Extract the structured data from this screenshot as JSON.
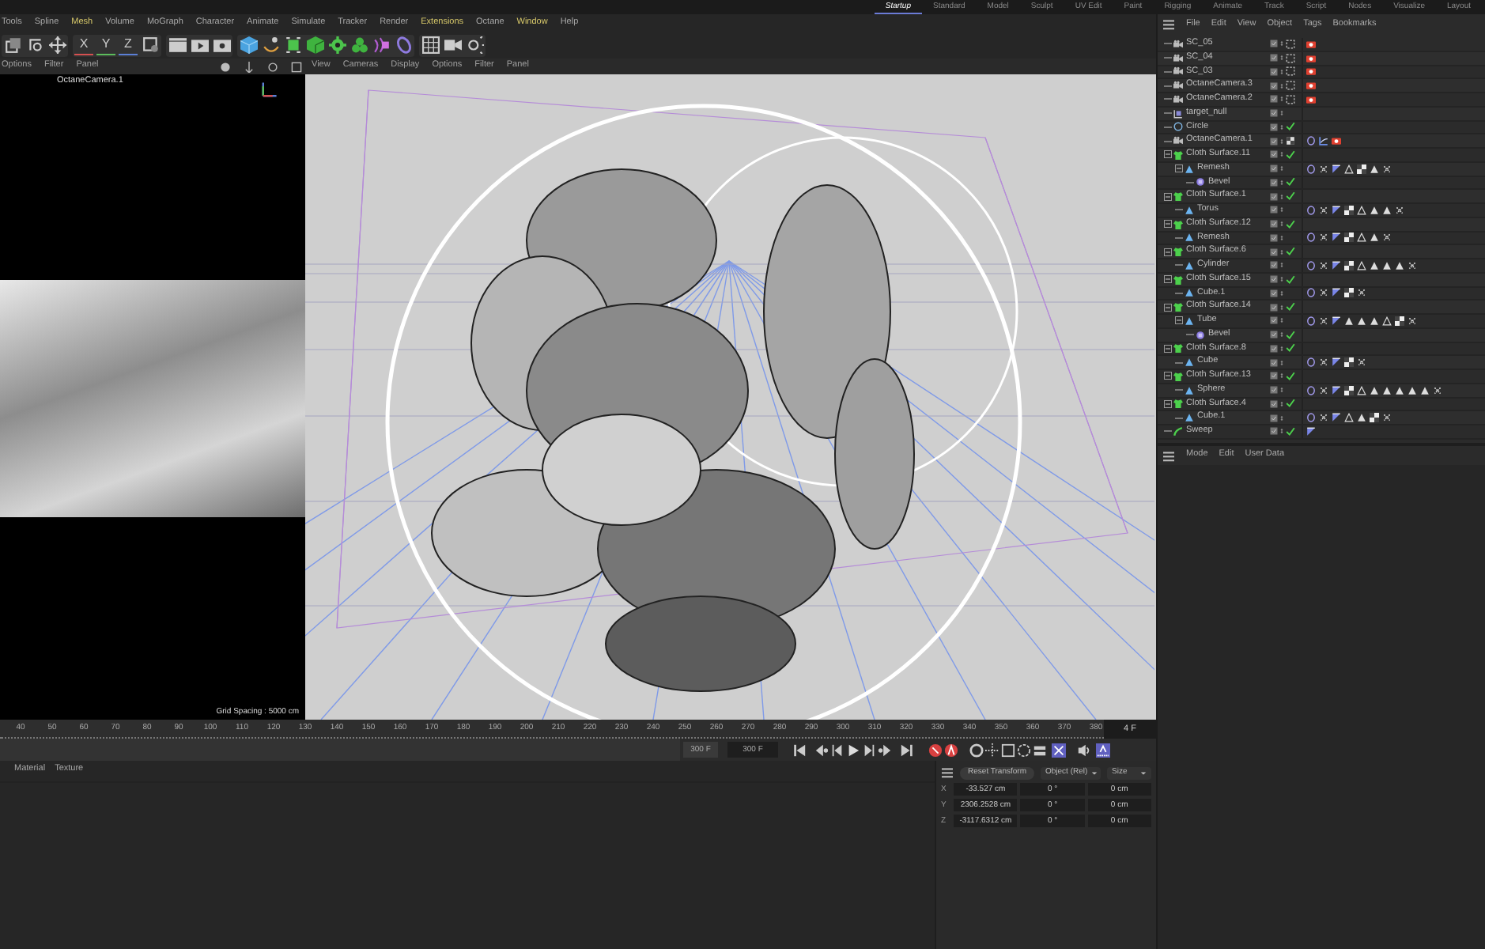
{
  "layouts": [
    {
      "label": "Startup",
      "selected": true
    },
    {
      "label": "Standard",
      "selected": false
    },
    {
      "label": "Model",
      "selected": false
    },
    {
      "label": "Sculpt",
      "selected": false
    },
    {
      "label": "UV Edit",
      "selected": false
    },
    {
      "label": "Paint",
      "selected": false
    },
    {
      "label": "Rigging",
      "selected": false
    },
    {
      "label": "Animate",
      "selected": false
    },
    {
      "label": "Track",
      "selected": false
    },
    {
      "label": "Script",
      "selected": false
    },
    {
      "label": "Nodes",
      "selected": false
    },
    {
      "label": "Visualize",
      "selected": false
    },
    {
      "label": "Layout",
      "selected": false
    }
  ],
  "menu": [
    {
      "label": "Tools",
      "highlight": false
    },
    {
      "label": "Spline",
      "highlight": false
    },
    {
      "label": "Mesh",
      "highlight": true
    },
    {
      "label": "Volume",
      "highlight": false
    },
    {
      "label": "MoGraph",
      "highlight": false
    },
    {
      "label": "Character",
      "highlight": false
    },
    {
      "label": "Animate",
      "highlight": false
    },
    {
      "label": "Simulate",
      "highlight": false
    },
    {
      "label": "Tracker",
      "highlight": false
    },
    {
      "label": "Render",
      "highlight": false
    },
    {
      "label": "Extensions",
      "highlight": true
    },
    {
      "label": "Octane",
      "highlight": false
    },
    {
      "label": "Window",
      "highlight": true
    },
    {
      "label": "Help",
      "highlight": false
    }
  ],
  "axis_buttons": [
    "X",
    "Y",
    "Z"
  ],
  "left_viewport": {
    "menu": [
      "Options",
      "Filter",
      "Panel"
    ],
    "camera": "OctaneCamera.1",
    "grid_spacing": "Grid Spacing : 5000 cm"
  },
  "viewport": {
    "menu": [
      "View",
      "Cameras",
      "Display",
      "Options",
      "Filter",
      "Panel"
    ]
  },
  "object_manager": {
    "menu": [
      "File",
      "Edit",
      "View",
      "Object",
      "Tags",
      "Bookmarks"
    ],
    "objects": [
      {
        "name": "SC_05",
        "kind": "camera",
        "check": false,
        "badge": {
          "kind": "dotted"
        },
        "tags": [
          {
            "kind": "red"
          }
        ]
      },
      {
        "name": "SC_04",
        "kind": "camera",
        "check": false,
        "badge": {
          "kind": "dotted"
        },
        "tags": [
          {
            "kind": "red"
          }
        ]
      },
      {
        "name": "SC_03",
        "kind": "camera",
        "check": false,
        "badge": {
          "kind": "dotted"
        },
        "tags": [
          {
            "kind": "red"
          }
        ]
      },
      {
        "name": "OctaneCamera.3",
        "kind": "camera",
        "check": false,
        "badge": {
          "kind": "dotted"
        },
        "tags": [
          {
            "kind": "red"
          }
        ]
      },
      {
        "name": "OctaneCamera.2",
        "kind": "camera",
        "check": false,
        "badge": {
          "kind": "dotted"
        },
        "tags": [
          {
            "kind": "red"
          }
        ]
      },
      {
        "name": "target_null",
        "kind": "null",
        "check": false
      },
      {
        "name": "Circle",
        "kind": "circle",
        "check": true
      },
      {
        "name": "OctaneCamera.1",
        "kind": "camera",
        "check": false,
        "badge": {
          "kind": "checker"
        },
        "tags": [
          {
            "kind": "octane"
          },
          {
            "kind": "curve"
          },
          {
            "kind": "red"
          }
        ]
      },
      {
        "name": "Cloth Surface.11",
        "kind": "cloth",
        "check": true,
        "expanded": true,
        "children": [
          {
            "name": "Remesh",
            "kind": "generator",
            "check": false,
            "expanded": true,
            "tags": [
              {
                "kind": "octane"
              },
              {
                "kind": "cross"
              },
              {
                "kind": "flag"
              },
              {
                "kind": "tri-outline"
              },
              {
                "kind": "checker"
              },
              {
                "kind": "tri"
              },
              {
                "kind": "cross"
              }
            ],
            "children": [
              {
                "name": "Bevel",
                "kind": "deformer",
                "check": true
              }
            ]
          }
        ]
      },
      {
        "name": "Cloth Surface.1",
        "kind": "cloth",
        "check": true,
        "expanded": true,
        "children": [
          {
            "name": "Torus",
            "kind": "generator",
            "check": false,
            "tags": [
              {
                "kind": "octane"
              },
              {
                "kind": "cross"
              },
              {
                "kind": "flag"
              },
              {
                "kind": "checker"
              },
              {
                "kind": "tri-outline"
              },
              {
                "kind": "tri"
              },
              {
                "kind": "tri"
              },
              {
                "kind": "cross"
              }
            ]
          }
        ]
      },
      {
        "name": "Cloth Surface.12",
        "kind": "cloth",
        "check": true,
        "expanded": true,
        "children": [
          {
            "name": "Remesh",
            "kind": "generator",
            "check": false,
            "tags": [
              {
                "kind": "octane"
              },
              {
                "kind": "cross"
              },
              {
                "kind": "flag"
              },
              {
                "kind": "checker"
              },
              {
                "kind": "tri-outline"
              },
              {
                "kind": "tri"
              },
              {
                "kind": "cross"
              }
            ]
          }
        ]
      },
      {
        "name": "Cloth Surface.6",
        "kind": "cloth",
        "check": true,
        "expanded": true,
        "children": [
          {
            "name": "Cylinder",
            "kind": "generator",
            "check": false,
            "tags": [
              {
                "kind": "octane"
              },
              {
                "kind": "cross"
              },
              {
                "kind": "flag"
              },
              {
                "kind": "checker"
              },
              {
                "kind": "tri-outline"
              },
              {
                "kind": "tri"
              },
              {
                "kind": "tri"
              },
              {
                "kind": "tri"
              },
              {
                "kind": "cross"
              }
            ]
          }
        ]
      },
      {
        "name": "Cloth Surface.15",
        "kind": "cloth",
        "check": true,
        "expanded": true,
        "children": [
          {
            "name": "Cube.1",
            "kind": "generator",
            "check": false,
            "tags": [
              {
                "kind": "octane"
              },
              {
                "kind": "cross"
              },
              {
                "kind": "flag"
              },
              {
                "kind": "checker"
              },
              {
                "kind": "cross"
              }
            ]
          }
        ]
      },
      {
        "name": "Cloth Surface.14",
        "kind": "cloth",
        "check": true,
        "expanded": true,
        "children": [
          {
            "name": "Tube",
            "kind": "generator",
            "check": false,
            "expanded": true,
            "tags": [
              {
                "kind": "octane"
              },
              {
                "kind": "cross"
              },
              {
                "kind": "flag"
              },
              {
                "kind": "tri"
              },
              {
                "kind": "tri"
              },
              {
                "kind": "tri"
              },
              {
                "kind": "tri-outline"
              },
              {
                "kind": "checker"
              },
              {
                "kind": "cross"
              }
            ],
            "children": [
              {
                "name": "Bevel",
                "kind": "deformer",
                "check": true
              }
            ]
          }
        ]
      },
      {
        "name": "Cloth Surface.8",
        "kind": "cloth",
        "check": true,
        "expanded": true,
        "children": [
          {
            "name": "Cube",
            "kind": "generator",
            "check": false,
            "tags": [
              {
                "kind": "octane"
              },
              {
                "kind": "cross"
              },
              {
                "kind": "flag"
              },
              {
                "kind": "checker"
              },
              {
                "kind": "cross"
              }
            ]
          }
        ]
      },
      {
        "name": "Cloth Surface.13",
        "kind": "cloth",
        "check": true,
        "expanded": true,
        "children": [
          {
            "name": "Sphere",
            "kind": "generator",
            "check": false,
            "tags": [
              {
                "kind": "octane"
              },
              {
                "kind": "cross"
              },
              {
                "kind": "flag"
              },
              {
                "kind": "checker"
              },
              {
                "kind": "tri-outline"
              },
              {
                "kind": "tri"
              },
              {
                "kind": "tri"
              },
              {
                "kind": "tri"
              },
              {
                "kind": "tri"
              },
              {
                "kind": "tri"
              },
              {
                "kind": "cross"
              }
            ]
          }
        ]
      },
      {
        "name": "Cloth Surface.4",
        "kind": "cloth",
        "check": true,
        "expanded": true,
        "children": [
          {
            "name": "Cube.1",
            "kind": "generator",
            "check": false,
            "tags": [
              {
                "kind": "octane"
              },
              {
                "kind": "cross"
              },
              {
                "kind": "flag"
              },
              {
                "kind": "tri-outline"
              },
              {
                "kind": "tri"
              },
              {
                "kind": "checker"
              },
              {
                "kind": "cross"
              }
            ]
          }
        ]
      },
      {
        "name": "Sweep",
        "kind": "sweep",
        "check": true,
        "tags": [
          {
            "kind": "flag"
          }
        ]
      }
    ]
  },
  "attribute_manager": {
    "menu": [
      "Mode",
      "Edit",
      "User Data"
    ]
  },
  "timeline": {
    "ticks": [
      "40",
      "50",
      "60",
      "70",
      "80",
      "90",
      "100",
      "110",
      "120",
      "130",
      "140",
      "150",
      "160",
      "170",
      "180",
      "190",
      "200",
      "210",
      "220",
      "230",
      "240",
      "250",
      "260",
      "270",
      "280",
      "290",
      "300",
      "310",
      "320",
      "330",
      "340",
      "350",
      "360",
      "370",
      "380"
    ],
    "current_frame": "4 F"
  },
  "transport": {
    "start": "300 F",
    "end": "300 F"
  },
  "material_manager": {
    "menu": [
      "Material",
      "Texture"
    ]
  },
  "coordinates": {
    "reset": "Reset Transform",
    "dropdowns": [
      "Object (Rel)",
      "Size"
    ],
    "rows": [
      {
        "axis": "X",
        "cells": [
          "-33.527 cm",
          "0 °",
          "0 cm"
        ]
      },
      {
        "axis": "Y",
        "cells": [
          "2306.2528 cm",
          "0 °",
          "0 cm"
        ]
      },
      {
        "axis": "Z",
        "cells": [
          "-3117.6312 cm",
          "0 °",
          "0 cm"
        ]
      }
    ]
  }
}
